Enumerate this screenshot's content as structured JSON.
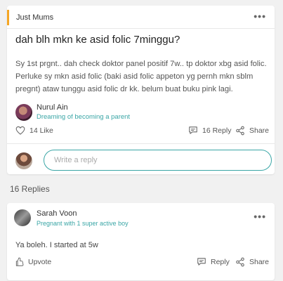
{
  "post": {
    "group": "Just Mums",
    "title": "dah blh mkn ke asid folic 7minggu?",
    "body": "Sy 1st prgnt.. dah check doktor panel positif 7w.. tp doktor xbg asid folic. Perluke sy mkn asid folic (baki asid folic appeton yg pernh mkn sblm pregnt) ataw tunggu asid folic dr kk. belum buat buku pink lagi.",
    "author": {
      "name": "Nurul Ain",
      "status": "Dreaming of becoming a parent"
    },
    "likes": "14 Like",
    "reply_count": "16 Reply",
    "share_label": "Share",
    "reply_placeholder": "Write a reply"
  },
  "replies_heading": "16 Replies",
  "reply": {
    "author": {
      "name": "Sarah Voon",
      "status": "Pregnant with 1 super active boy"
    },
    "body": "Ya boleh. I started at 5w",
    "upvote_label": "Upvote",
    "reply_label": "Reply",
    "share_label": "Share"
  },
  "colors": {
    "accent": "#3aa6a6",
    "group_tag": "#f5a623"
  },
  "icons": [
    "more-icon",
    "heart-icon",
    "comment-icon",
    "share-icon",
    "upvote-icon"
  ]
}
